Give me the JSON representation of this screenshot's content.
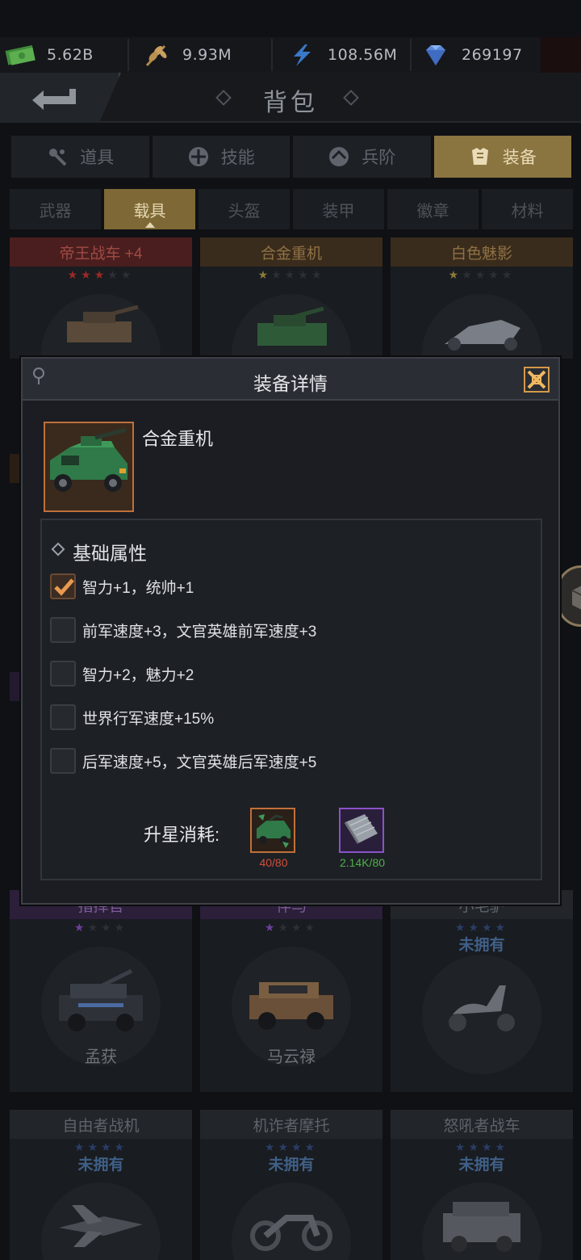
{
  "resources": [
    {
      "icon": "cash-icon",
      "value": "5.62B"
    },
    {
      "icon": "wheat-icon",
      "value": "9.93M"
    },
    {
      "icon": "lightning-icon",
      "value": "108.56M"
    },
    {
      "icon": "diamond-icon",
      "value": "269197"
    }
  ],
  "header": {
    "title": "背包"
  },
  "tabs": [
    {
      "label": "道具",
      "icon": "items-icon"
    },
    {
      "label": "技能",
      "icon": "skills-icon"
    },
    {
      "label": "兵阶",
      "icon": "rank-icon"
    },
    {
      "label": "装备",
      "icon": "equipment-icon",
      "active": true
    }
  ],
  "subtabs": [
    {
      "label": "武器"
    },
    {
      "label": "载具",
      "active": true
    },
    {
      "label": "头盔"
    },
    {
      "label": "装甲"
    },
    {
      "label": "徽章"
    },
    {
      "label": "材料"
    }
  ],
  "grid": {
    "row1": [
      {
        "name": "帝王战车 +4",
        "stars": 3,
        "max_stars": 5
      },
      {
        "name": "合金重机",
        "stars": 1,
        "max_stars": 5
      },
      {
        "name": "白色魅影",
        "stars": 1,
        "max_stars": 5
      }
    ],
    "row4": [
      {
        "name": "指挥官",
        "stars": 1,
        "max_stars": 4,
        "owner": "孟获"
      },
      {
        "name": "伴马",
        "stars": 1,
        "max_stars": 4,
        "owner": "马云禄"
      },
      {
        "name": "小毛驴",
        "stars": 0,
        "max_stars": 4,
        "status": "未拥有"
      }
    ],
    "row5": [
      {
        "name": "自由者战机",
        "stars": 0,
        "max_stars": 4,
        "status": "未拥有"
      },
      {
        "name": "机诈者摩托",
        "stars": 0,
        "max_stars": 4,
        "status": "未拥有"
      },
      {
        "name": "怒吼者战车",
        "stars": 0,
        "max_stars": 4,
        "status": "未拥有"
      }
    ]
  },
  "modal": {
    "title": "装备详情",
    "item_name": "合金重机",
    "section_title": "基础属性",
    "attributes": [
      {
        "text": "智力+1，统帅+1",
        "checked": true
      },
      {
        "text": "前军速度+3，文官英雄前军速度+3",
        "checked": false
      },
      {
        "text": "智力+2，魅力+2",
        "checked": false
      },
      {
        "text": "世界行军速度+15%",
        "checked": false
      },
      {
        "text": "后军速度+5，文官英雄后军速度+5",
        "checked": false
      }
    ],
    "cost_label": "升星消耗:",
    "costs": [
      {
        "icon": "vehicle-fragment-icon",
        "amount": "40/80",
        "color": "#d0503a"
      },
      {
        "icon": "steel-plate-icon",
        "amount": "2.14K/80",
        "color": "#4fb04a"
      }
    ]
  }
}
